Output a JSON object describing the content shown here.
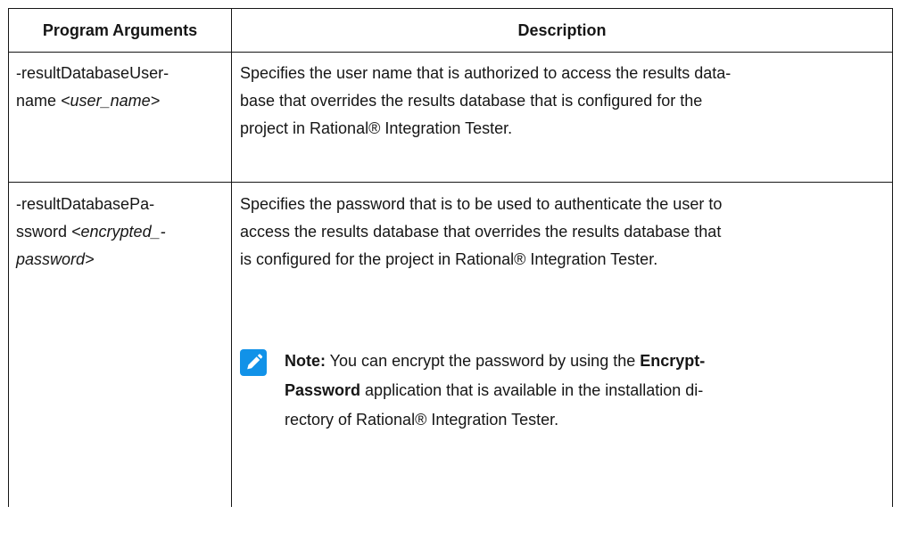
{
  "header": {
    "col1": "Program Arguments",
    "col2": "Description"
  },
  "rows": [
    {
      "arg_line1": "-resultDatabaseUser-",
      "arg_line2_plain": "name ",
      "arg_line2_italic": "<user_name>",
      "desc_lines": [
        "Specifies the user name that is authorized to access the results data-",
        "base that overrides the results database that is configured for the",
        "project in  Rational® Integration Tester."
      ]
    },
    {
      "arg_line1": "-resultDatabasePa-",
      "arg_line2_plain": "ssword ",
      "arg_line2_italic": "<encrypted_-",
      "arg_line3_italic": "password>",
      "desc_lines": [
        "Specifies the password that is to be used to authenticate the user to",
        "access the results database that overrides the results database that",
        "is configured for the project in  Rational® Integration Tester."
      ],
      "note": {
        "icon": "pencil-note-icon",
        "icon_color": "#1192e8",
        "label": "Note:",
        "line1_text": " You can encrypt the password by using the ",
        "line1_bold": "Encrypt-",
        "line2_bold": "Password",
        "line2_text": " application that is available in the installation di-",
        "line3_text": "rectory of  Rational® Integration Tester."
      }
    }
  ]
}
